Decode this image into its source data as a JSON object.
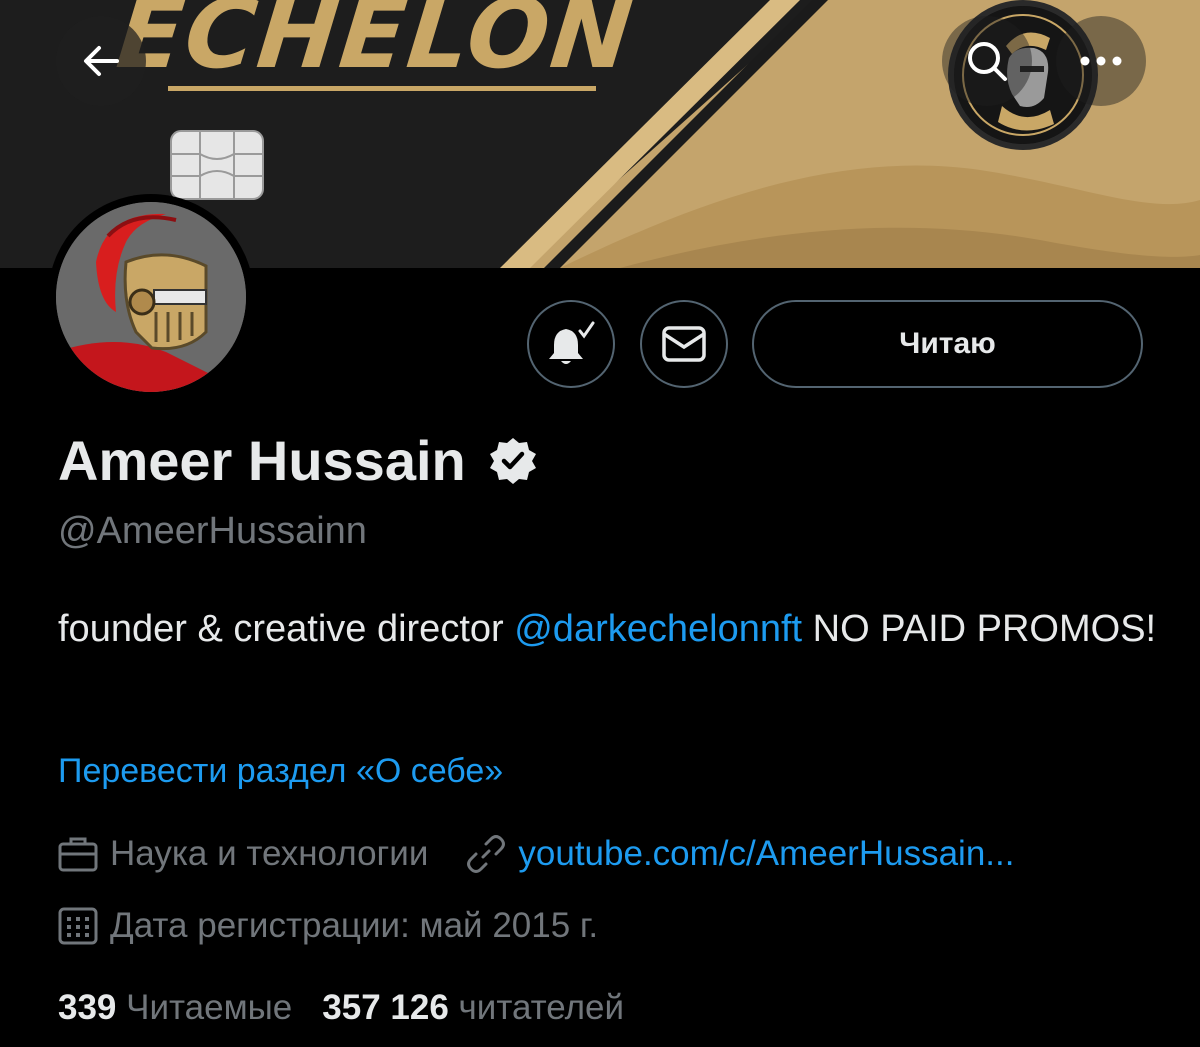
{
  "banner": {
    "word": "ECHELON"
  },
  "nav": {
    "back_icon": "arrow-left-icon",
    "search_icon": "search-icon",
    "more_icon": "more-horizontal-icon"
  },
  "actions": {
    "notify_icon": "bell-check-icon",
    "message_icon": "envelope-icon",
    "follow_label": "Читаю"
  },
  "profile": {
    "display_name": "Ameer Hussain",
    "verified_icon": "verified-badge-icon",
    "handle": "@AmeerHussainn",
    "bio": {
      "before": "founder & creative director ",
      "mention": "@darkechelonnft",
      "after": " NO PAID PROMOS!"
    },
    "translate_label": "Перевести раздел «О себе»",
    "category": "Наука и технологии",
    "link": "youtube.com/c/AmeerHussain...",
    "joined": "Дата регистрации: май 2015 г."
  },
  "stats": {
    "following_count": "339",
    "following_label": "Читаемые",
    "followers_count": "357 126",
    "followers_label": "читателей"
  },
  "colors": {
    "accent": "#1d9bf0",
    "gold": "#c9a766",
    "secondary_text": "#71767b",
    "background": "#000000"
  }
}
